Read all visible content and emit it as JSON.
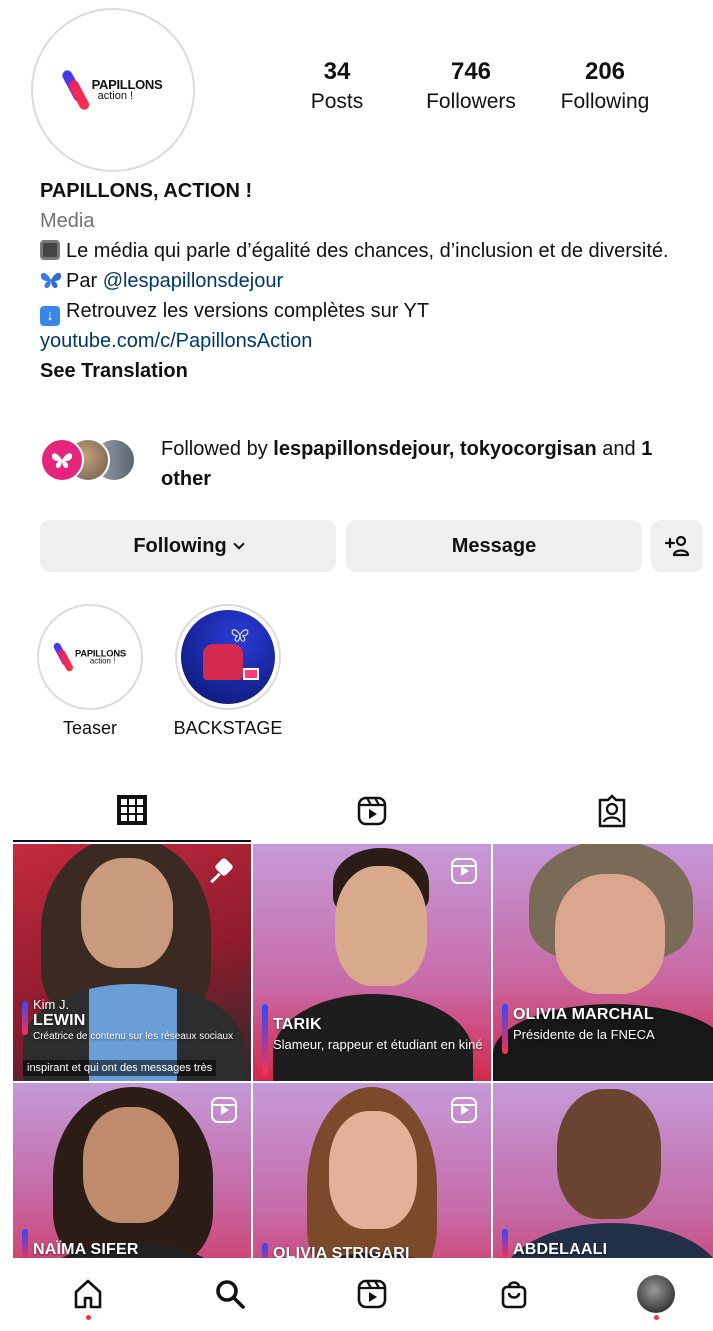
{
  "profile": {
    "logo_line1": "PAPILLONS",
    "logo_line2": "action !",
    "stats": [
      {
        "value": "34",
        "label": "Posts"
      },
      {
        "value": "746",
        "label": "Followers"
      },
      {
        "value": "206",
        "label": "Following"
      }
    ],
    "name": "PAPILLONS, ACTION !",
    "category": "Media",
    "bio_line1": "Le média qui parle d’égalité des chances, d’inclusion et de diversité.",
    "bio_line2_prefix": "Par ",
    "bio_mention": "@lespapillonsdejour",
    "bio_line3": "Retrouvez les versions complètes sur YT",
    "link": "youtube.com/c/PapillonsAction",
    "see_translation": "See Translation",
    "followed_by_prefix": "Followed by ",
    "followed_by_names": "lespapillonsdejour, tokyocorgisan",
    "followed_by_and": " and ",
    "followed_by_other": "1 other"
  },
  "actions": {
    "following": "Following",
    "message": "Message",
    "add_user_icon": "+person-icon"
  },
  "highlights": [
    {
      "label": "Teaser"
    },
    {
      "label": "BACKSTAGE"
    }
  ],
  "tabs": [
    "grid-icon",
    "reels-icon",
    "tagged-icon"
  ],
  "posts": [
    {
      "line1": "Kim J.",
      "line2": "LEWIN",
      "line3": "Créatrice de contenu sur les réseaux sociaux",
      "subtitle": "inspirant et qui ont des messages très"
    },
    {
      "line1": "TARIK",
      "line2": "Slameur, rappeur et étudiant en kiné"
    },
    {
      "line1": "OLIVIA MARCHAL",
      "line2": "Présidente de la FNECA"
    },
    {
      "line1": "NAÏMA SIFER"
    },
    {
      "line1": "OLIVIA STRIGARI"
    },
    {
      "line1": "ABDELAALI"
    }
  ],
  "colors": {
    "link": "#00376b",
    "accent_red": "#ff3040",
    "button_bg": "#efefef"
  }
}
